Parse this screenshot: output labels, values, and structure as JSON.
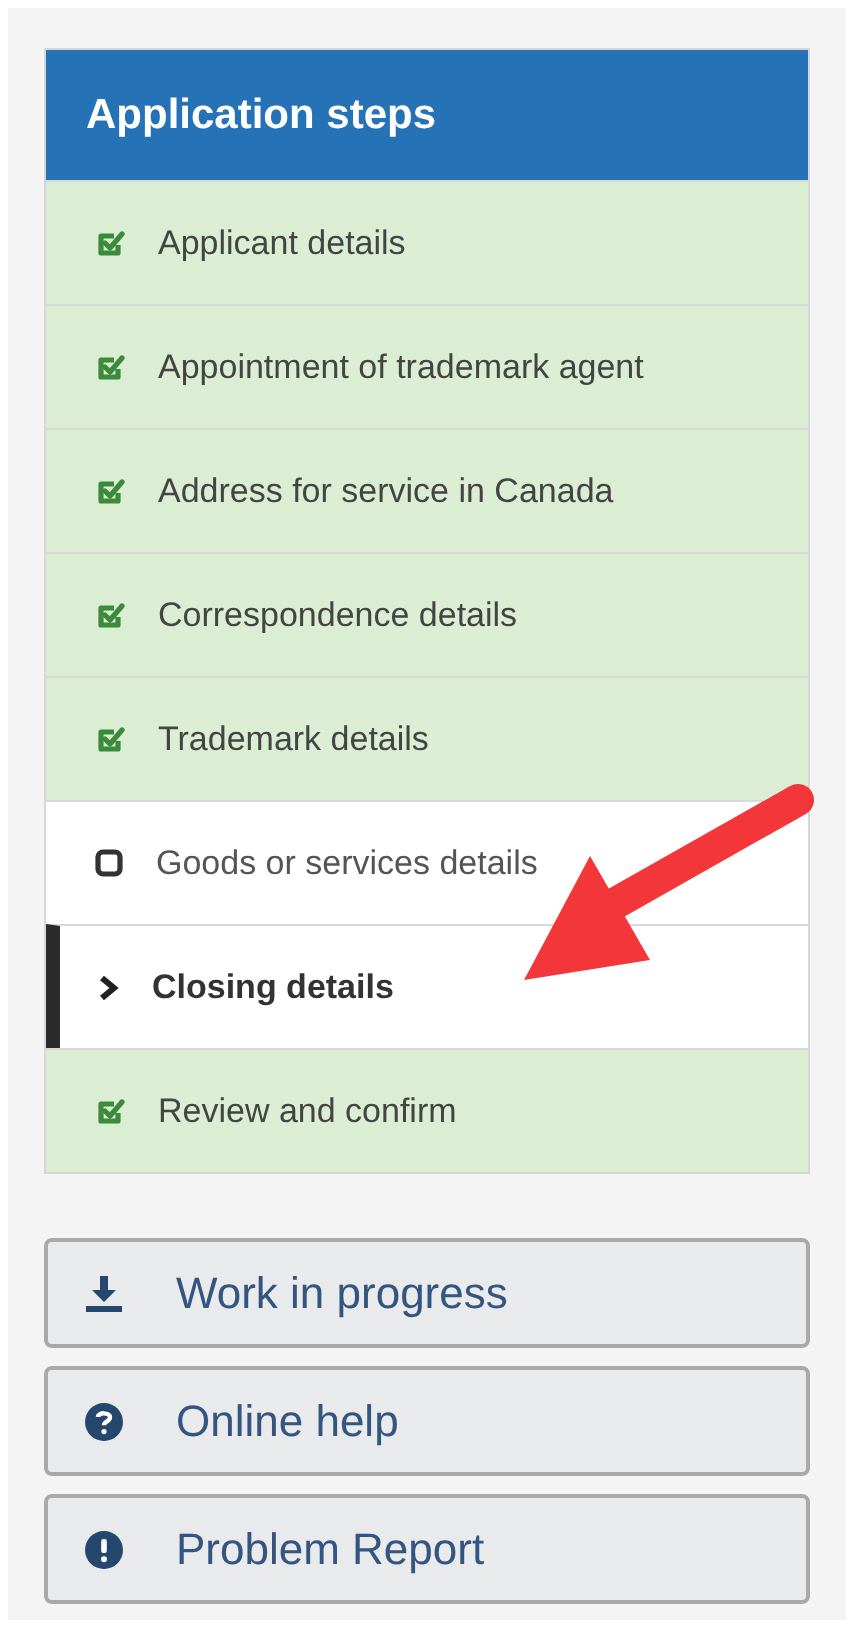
{
  "panel": {
    "title": "Application steps",
    "steps": [
      {
        "label": "Applicant details",
        "kind": "done"
      },
      {
        "label": "Appointment of trademark agent",
        "kind": "done"
      },
      {
        "label": "Address for service in Canada",
        "kind": "done"
      },
      {
        "label": "Correspondence details",
        "kind": "done"
      },
      {
        "label": "Trademark details",
        "kind": "done"
      },
      {
        "label": "Goods or services details",
        "kind": "todo"
      },
      {
        "label": "Closing details",
        "kind": "current"
      },
      {
        "label": "Review and confirm",
        "kind": "done"
      }
    ]
  },
  "buttons": [
    {
      "label": "Work in progress",
      "kind": "download"
    },
    {
      "label": "Online help",
      "kind": "help"
    },
    {
      "label": "Problem Report",
      "kind": "alert"
    }
  ],
  "annotation": {
    "kind": "arrow"
  }
}
